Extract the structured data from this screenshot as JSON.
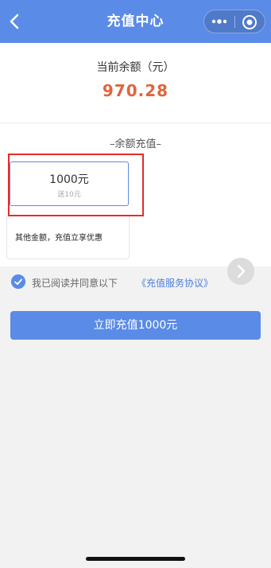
{
  "header": {
    "title": "充值中心",
    "back_icon": "chevron-left-icon",
    "more_icon": "more-dots-icon",
    "close_icon": "target-circle-icon"
  },
  "balance": {
    "label": "当前余额（元）",
    "value": "970.28"
  },
  "recharge": {
    "section_title": "–余额充值–",
    "options": [
      {
        "amount": "1000元",
        "bonus": "送10元",
        "selected": true
      },
      {
        "text": "其他金额，充值立享优惠"
      }
    ]
  },
  "agreement": {
    "checked": true,
    "text": "我已阅读并同意以下",
    "link": "《充值服务协议》"
  },
  "pay_button": {
    "label": "立即充值1000元"
  },
  "colors": {
    "brand": "#5a8be6",
    "balance": "#e0653f",
    "highlight": "#e62a2a"
  }
}
